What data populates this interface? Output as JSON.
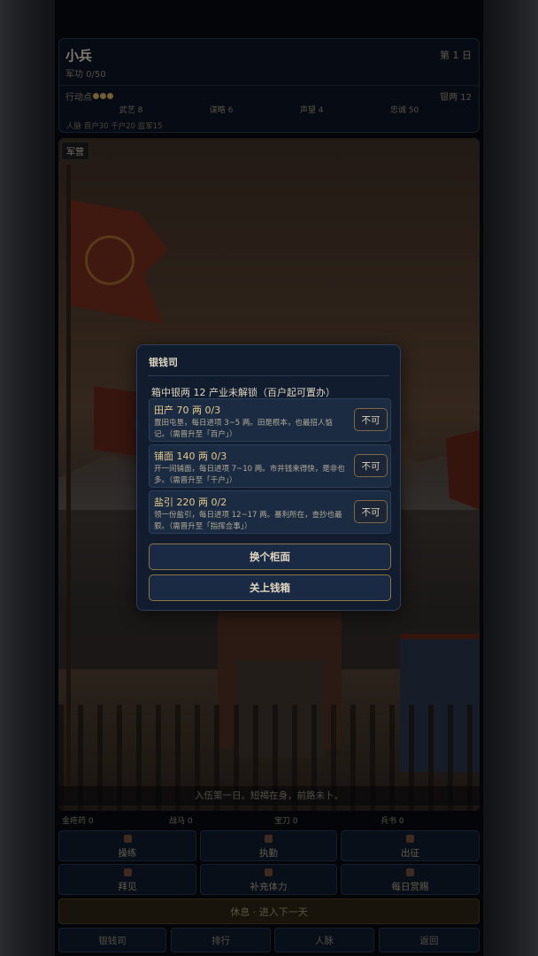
{
  "status": {
    "name": "小兵",
    "day": "第 1 日",
    "merit": "军功 0/50",
    "action_points_label": "行动点",
    "action_points": 3,
    "silver": "银两 12",
    "stats": [
      "武艺 8",
      "谋略 6",
      "声望 4",
      "忠诚 50"
    ],
    "network": "人脉 百户30 千户20 监军15"
  },
  "scene": {
    "tag": "军营",
    "caption": "入伍第一日。短褐在身，前路未卜。"
  },
  "modal": {
    "title": "银钱司",
    "summary": "箱中银两 12    产业未解锁（百户起可置办）",
    "items": [
      {
        "title": "田产    70 两    0/3",
        "desc": "置田屯垦，每日进项 3~5 两。田是根本，也最招人惦记。（需晋升至「百户」）",
        "button": "不可"
      },
      {
        "title": "铺面    140 两    0/3",
        "desc": "开一间铺面，每日进项 7~10 两。市井钱来得快，是非也多。（需晋升至「千户」）",
        "button": "不可"
      },
      {
        "title": "盐引    220 两    0/2",
        "desc": "领一份盐引，每日进项 12~17 两。暴利所在，查抄也最狠。（需晋升至「指挥佥事」）",
        "button": "不可"
      }
    ],
    "swap_button": "换个柜面",
    "close_button": "关上钱箱"
  },
  "inventory": {
    "medicine": "金疮药 0",
    "horse": "战马 0",
    "sword": "宝刀 0",
    "book": "兵书 0"
  },
  "actions": {
    "drill": "操练",
    "duty": "执勤",
    "campaign": "出征",
    "visit": "拜见",
    "stamina": "补充体力",
    "daily_reward": "每日赏赐",
    "rest": "休息 · 进入下一天"
  },
  "nav": {
    "bank": "银钱司",
    "ranking": "排行",
    "network": "人脉",
    "back": "返回"
  }
}
